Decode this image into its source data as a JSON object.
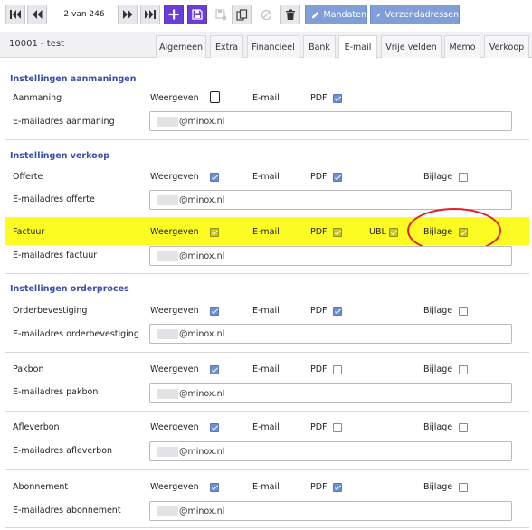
{
  "toolbar": {
    "pager_text": "2 van 246",
    "mandaten_label": "Mandaten",
    "verzendadressen_label": "Verzendadressen"
  },
  "header": {
    "record": "10001 - test",
    "tabs": [
      "Algemeen",
      "Extra",
      "Financieel",
      "Bank",
      "E-mail",
      "Vrije velden",
      "Memo",
      "Verkoop"
    ],
    "active_tab": "E-mail"
  },
  "col_labels": {
    "weergeven": "Weergeven",
    "email": "E-mail",
    "pdf": "PDF",
    "ubl": "UBL",
    "bijlage": "Bijlage"
  },
  "email_domain": "@minox.nl",
  "sections": {
    "aanmaningen": {
      "title": "Instellingen aanmaningen",
      "rows": {
        "aanmaning": {
          "label": "Aanmaning",
          "email_label": "E-mailadres aanmaning",
          "weergeven": false,
          "pdf": true
        }
      }
    },
    "verkoop": {
      "title": "Instellingen verkoop",
      "rows": {
        "offerte": {
          "label": "Offerte",
          "email_label": "E-mailadres offerte",
          "weergeven": true,
          "pdf": true,
          "bijlage": false
        },
        "factuur": {
          "label": "Factuur",
          "email_label": "E-mailadres factuur",
          "weergeven": true,
          "pdf": true,
          "ubl": true,
          "bijlage": true
        }
      }
    },
    "orderproces": {
      "title": "Instellingen orderproces",
      "rows": {
        "orderbevestiging": {
          "label": "Orderbevestiging",
          "email_label": "E-mailadres orderbevestiging",
          "weergeven": true,
          "pdf": true,
          "bijlage": false
        },
        "pakbon": {
          "label": "Pakbon",
          "email_label": "E-mailadres pakbon",
          "weergeven": true,
          "pdf": false,
          "bijlage": false
        },
        "afleverbon": {
          "label": "Afleverbon",
          "email_label": "E-mailadres afleverbon",
          "weergeven": true,
          "pdf": false,
          "bijlage": false
        },
        "abonnement": {
          "label": "Abonnement",
          "email_label": "E-mailadres abonnement",
          "weergeven": true,
          "pdf": true,
          "bijlage": false
        }
      }
    }
  },
  "colors": {
    "accent": "#6a3dd8",
    "button_blue": "#7f9fd6",
    "section_title": "#3b4fa8",
    "highlight": "#fcfc22",
    "annotation_red": "#e0202a"
  },
  "icons": [
    "first-page-icon",
    "prev-page-icon",
    "next-page-icon",
    "last-page-icon",
    "add-icon",
    "save-icon",
    "save-disabled-icon",
    "copy-icon",
    "block-icon",
    "trash-icon",
    "pencil-icon"
  ]
}
